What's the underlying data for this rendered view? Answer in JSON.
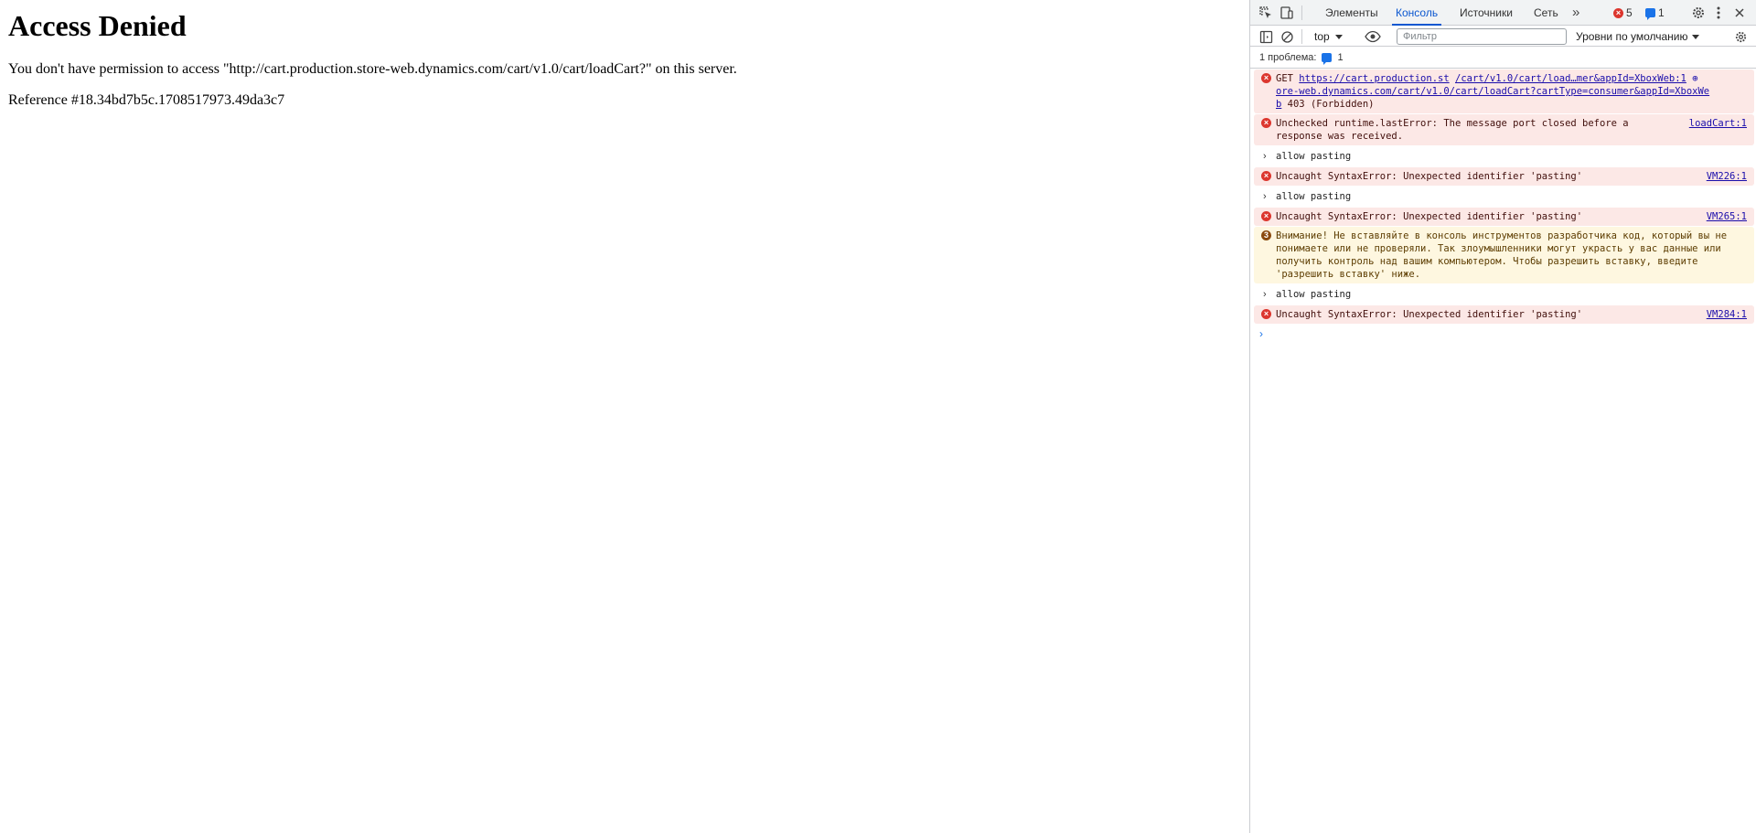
{
  "page": {
    "heading": "Access Denied",
    "message": "You don't have permission to access \"http://cart.production.store-web.dynamics.com/cart/v1.0/cart/loadCart?\" on this server.",
    "reference": "Reference #18.34bd7b5c.1708517973.49da3c7"
  },
  "devtools": {
    "tabs": [
      "Элементы",
      "Консоль",
      "Источники",
      "Сеть"
    ],
    "active_tab": "Консоль",
    "more_tabs": "»",
    "error_count": "5",
    "message_count": "1",
    "toolbar": {
      "context": "top",
      "filter_placeholder": "Фильтр",
      "levels": "Уровни по умолчанию"
    },
    "issues": {
      "label": "1 проблема:",
      "count": "1"
    },
    "console": {
      "get_row": {
        "method": "GET",
        "url_a": "https://cart.production.st",
        "url_b": "ore-web.dynamics.com/cart/v1.0/cart/loadCart?cartType=consumer&appId=XboxWe",
        "url_c": "b",
        "status": "403 (Forbidden)",
        "source": "/cart/v1.0/cart/load…mer&appId=XboxWeb:1"
      },
      "runtime_row": {
        "text": "Unchecked runtime.lastError: The message port closed before a response was received.",
        "source": "loadCart:1"
      },
      "cmd_1": "allow pasting",
      "err_1": {
        "text": "Uncaught SyntaxError: Unexpected identifier 'pasting'",
        "source": "VM226:1"
      },
      "cmd_2": "allow pasting",
      "err_2": {
        "text": "Uncaught SyntaxError: Unexpected identifier 'pasting'",
        "source": "VM265:1"
      },
      "warning": {
        "count": "3",
        "text": "Внимание! Не вставляйте в консоль инструментов разработчика код, который вы не понимаете или не проверяли. Так злоумышленники могут украсть у вас данные или получить контроль над вашим компьютером. Чтобы разрешить вставку, введите 'разрешить вставку' ниже."
      },
      "cmd_3": "allow pasting",
      "err_3": {
        "text": "Uncaught SyntaxError: Unexpected identifier 'pasting'",
        "source": "VM284:1"
      },
      "prompt": "›"
    }
  }
}
